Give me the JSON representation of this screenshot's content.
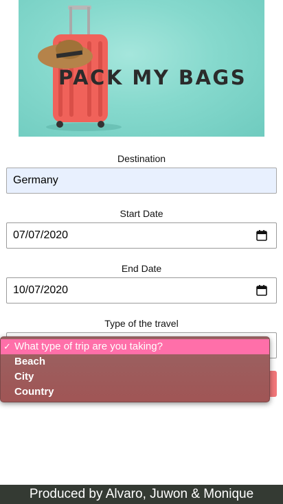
{
  "hero": {
    "title": "PACK MY BAGS"
  },
  "form": {
    "destination": {
      "label": "Destination",
      "value": "Germany"
    },
    "start_date": {
      "label": "Start Date",
      "value": "07/07/2020"
    },
    "end_date": {
      "label": "End Date",
      "value": "10/07/2020"
    },
    "travel_type": {
      "label": "Type of the travel",
      "options": [
        "What type of trip are you taking?",
        "Beach",
        "City",
        "Country"
      ],
      "selected_index": 0
    }
  },
  "footer": {
    "text": "Produced by Alvaro, Juwon & Monique"
  },
  "colors": {
    "hero_bg": "#86d9cd",
    "suitcase": "#f0625a",
    "submit": "#f2777a",
    "dropdown_selected": "#ff6fa9",
    "footer_bg": "#343a33"
  },
  "icons": [
    "suitcase",
    "hat",
    "calendar-icon",
    "check-icon"
  ]
}
